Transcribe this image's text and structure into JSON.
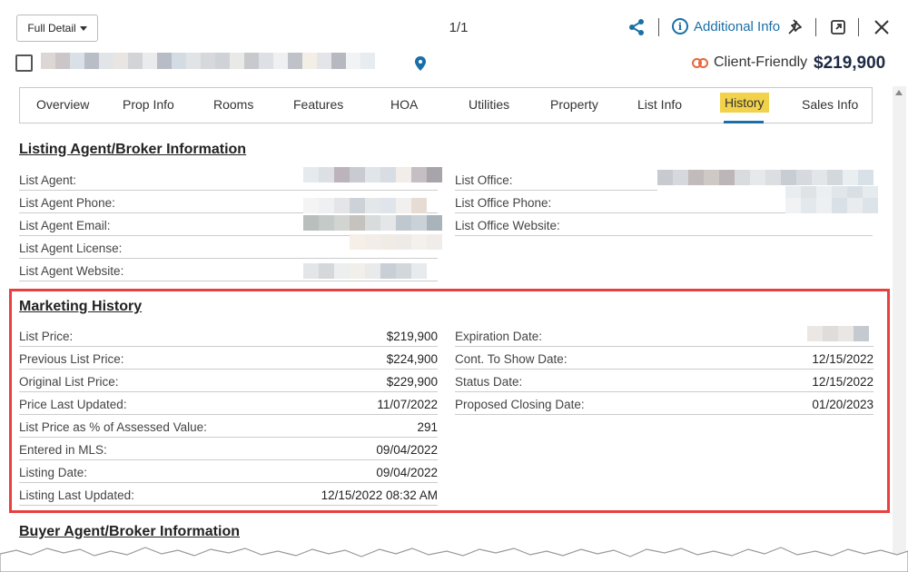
{
  "header": {
    "view_label": "Full Detail",
    "pager": "1/1",
    "additional_info_label": "Additional Info",
    "client_friendly_label": "Client-Friendly",
    "price": "$219,900"
  },
  "tabs": [
    {
      "label": "Overview"
    },
    {
      "label": "Prop Info"
    },
    {
      "label": "Rooms"
    },
    {
      "label": "Features"
    },
    {
      "label": "HOA"
    },
    {
      "label": "Utilities"
    },
    {
      "label": "Property"
    },
    {
      "label": "List Info"
    },
    {
      "label": "History",
      "active": true
    },
    {
      "label": "Sales Info"
    }
  ],
  "listing_agent": {
    "title": "Listing Agent/Broker Information",
    "left_rows": [
      {
        "label": "List Agent:"
      },
      {
        "label": "List Agent Phone:"
      },
      {
        "label": "List Agent Email:"
      },
      {
        "label": "List Agent License:"
      },
      {
        "label": "List Agent Website:"
      }
    ],
    "right_rows": [
      {
        "label": "List Office:"
      },
      {
        "label": "List Office Phone:"
      },
      {
        "label": "List Office Website:"
      }
    ]
  },
  "marketing_history": {
    "title": "Marketing History",
    "left_rows": [
      {
        "label": "List Price:",
        "value": "$219,900"
      },
      {
        "label": "Previous List Price:",
        "value": "$224,900"
      },
      {
        "label": "Original List Price:",
        "value": "$229,900"
      },
      {
        "label": "Price Last Updated:",
        "value": "11/07/2022"
      },
      {
        "label": "List Price as % of Assessed Value:",
        "value": "291"
      },
      {
        "label": "Entered in MLS:",
        "value": "09/04/2022"
      },
      {
        "label": "Listing Date:",
        "value": "09/04/2022"
      },
      {
        "label": "Listing Last Updated:",
        "value": "12/15/2022 08:32 AM"
      }
    ],
    "right_rows": [
      {
        "label": "Expiration Date:",
        "value": ""
      },
      {
        "label": "Cont. To Show Date:",
        "value": "12/15/2022"
      },
      {
        "label": "Status Date:",
        "value": "12/15/2022"
      },
      {
        "label": "Proposed Closing Date:",
        "value": "01/20/2023"
      }
    ]
  },
  "buyer_agent": {
    "title": "Buyer Agent/Broker Information"
  },
  "colors": {
    "accent": "#1a6fa8",
    "active_tab": "#f2d24b",
    "highlight": "#e8403f",
    "client_friendly": "#e8673c",
    "price": "#1d2a44"
  }
}
